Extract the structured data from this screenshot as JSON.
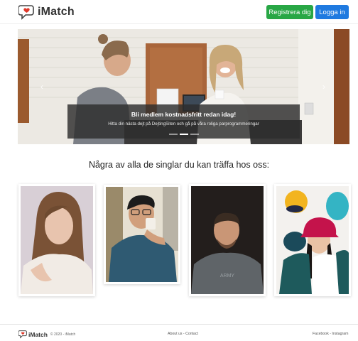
{
  "brand": {
    "name": "iMatch",
    "icon": "heart-chat-bubble-icon",
    "accent": "#e0392b"
  },
  "nav": {
    "register_label": "Registrera dig",
    "login_label": "Logga in",
    "register_color": "#28a745",
    "login_color": "#1f7ae0"
  },
  "hero": {
    "caption_title": "Bli medlem kostnadsfritt redan idag!",
    "caption_text": "Hitta din nästa dejt på DejtingSiten och gå på våra roliga parprogrammeringar",
    "slide_count": 3,
    "active_slide": 2,
    "prev_icon": "chevron-left-icon",
    "next_icon": "chevron-right-icon"
  },
  "section": {
    "title": "Några av alla de singlar du kan träffa hos oss:"
  },
  "profiles": [
    {
      "photo": "woman-white-sweater-photo"
    },
    {
      "photo": "man-drinking-coffee-photo"
    },
    {
      "photo": "man-grey-tshirt-photo"
    },
    {
      "photo": "woman-colorful-hats-photo"
    }
  ],
  "footer": {
    "brand": "iMatch",
    "copyright": "© 2020 - iMatch",
    "middle_links": "About us - Contact",
    "social_links": "Facebook - Instagram"
  }
}
